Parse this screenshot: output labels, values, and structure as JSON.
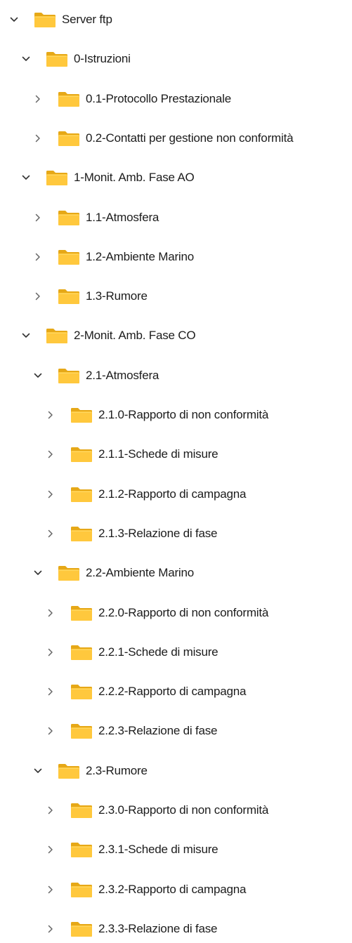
{
  "tree": {
    "nodes": [
      {
        "label": "Server ftp",
        "level": 0,
        "expanded": true
      },
      {
        "label": "0-Istruzioni",
        "level": 1,
        "expanded": true
      },
      {
        "label": "0.1-Protocollo Prestazionale",
        "level": 2,
        "expanded": false
      },
      {
        "label": "0.2-Contatti per gestione non conformità",
        "level": 2,
        "expanded": false
      },
      {
        "label": "1-Monit. Amb. Fase AO",
        "level": 1,
        "expanded": true
      },
      {
        "label": "1.1-Atmosfera",
        "level": 2,
        "expanded": false
      },
      {
        "label": "1.2-Ambiente Marino",
        "level": 2,
        "expanded": false
      },
      {
        "label": "1.3-Rumore",
        "level": 2,
        "expanded": false
      },
      {
        "label": "2-Monit. Amb. Fase CO",
        "level": 1,
        "expanded": true
      },
      {
        "label": "2.1-Atmosfera",
        "level": 2,
        "expanded": true
      },
      {
        "label": "2.1.0-Rapporto di non conformità",
        "level": 3,
        "expanded": false
      },
      {
        "label": "2.1.1-Schede di misure",
        "level": 3,
        "expanded": false
      },
      {
        "label": "2.1.2-Rapporto di campagna",
        "level": 3,
        "expanded": false
      },
      {
        "label": "2.1.3-Relazione di fase",
        "level": 3,
        "expanded": false
      },
      {
        "label": "2.2-Ambiente Marino",
        "level": 2,
        "expanded": true
      },
      {
        "label": "2.2.0-Rapporto di non conformità",
        "level": 3,
        "expanded": false
      },
      {
        "label": "2.2.1-Schede di misure",
        "level": 3,
        "expanded": false
      },
      {
        "label": "2.2.2-Rapporto di campagna",
        "level": 3,
        "expanded": false
      },
      {
        "label": "2.2.3-Relazione di fase",
        "level": 3,
        "expanded": false
      },
      {
        "label": "2.3-Rumore",
        "level": 2,
        "expanded": true
      },
      {
        "label": "2.3.0-Rapporto di non conformità",
        "level": 3,
        "expanded": false
      },
      {
        "label": "2.3.1-Schede di misure",
        "level": 3,
        "expanded": false
      },
      {
        "label": "2.3.2-Rapporto di campagna",
        "level": 3,
        "expanded": false
      },
      {
        "label": "2.3.3-Relazione di fase",
        "level": 3,
        "expanded": false
      }
    ]
  },
  "icons": {
    "expanded": "chevron-down-icon",
    "collapsed": "chevron-right-icon",
    "folder": "folder-icon"
  },
  "colors": {
    "folder_back": "#E6A817",
    "folder_front": "#FFC83D",
    "folder_light": "#FFD966",
    "chevron": "#333333",
    "text": "#1c1c1c",
    "background": "#ffffff"
  }
}
